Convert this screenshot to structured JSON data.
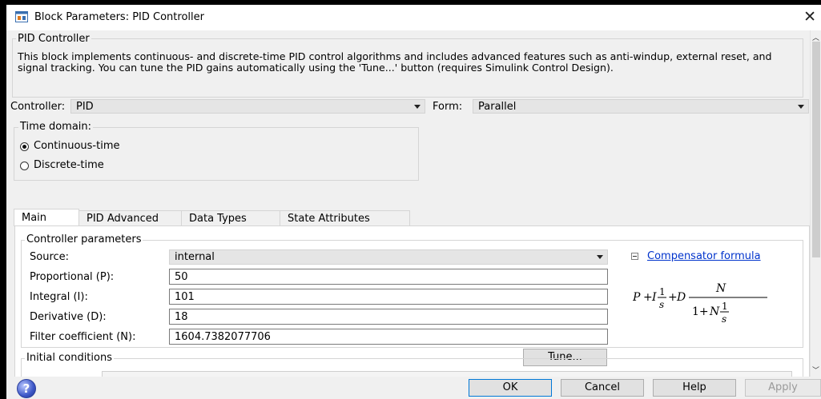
{
  "window": {
    "title": "Block Parameters: PID Controller"
  },
  "block": {
    "name": "PID Controller",
    "description": "This block implements continuous- and discrete-time PID control algorithms and includes advanced features such as anti-windup, external reset, and signal tracking. You can tune the PID gains automatically using the 'Tune...' button (requires Simulink Control Design)."
  },
  "controller": {
    "label": "Controller:",
    "value": "PID"
  },
  "form": {
    "label": "Form:",
    "value": "Parallel"
  },
  "time_domain": {
    "title": "Time domain:",
    "options": [
      {
        "label": "Continuous-time",
        "selected": true
      },
      {
        "label": "Discrete-time",
        "selected": false
      }
    ]
  },
  "tabs": [
    {
      "label": "Main",
      "active": true
    },
    {
      "label": "PID Advanced",
      "active": false
    },
    {
      "label": "Data Types",
      "active": false
    },
    {
      "label": "State Attributes",
      "active": false
    }
  ],
  "controller_parameters": {
    "title": "Controller parameters",
    "source": {
      "label": "Source:",
      "value": "internal"
    },
    "proportional": {
      "label": "Proportional (P):",
      "value": "50"
    },
    "integral": {
      "label": "Integral (I):",
      "value": "101"
    },
    "derivative": {
      "label": "Derivative (D):",
      "value": "18"
    },
    "filter": {
      "label": "Filter coefficient (N):",
      "value": "1604.7382077706"
    },
    "tune_label": "Tune...",
    "compensator_link": "Compensator formula"
  },
  "formula": {
    "P": "P",
    "plus1": "+",
    "I": "I",
    "one1": "1",
    "s1": "s",
    "plus2": "+",
    "D": "D",
    "N_num": "N",
    "one_plus": "1+",
    "N_den": "N",
    "one2": "1",
    "s2": "s"
  },
  "initial_conditions": {
    "title": "Initial conditions"
  },
  "buttons": {
    "ok": "OK",
    "cancel": "Cancel",
    "help": "Help",
    "apply": "Apply"
  },
  "icons": [
    "block-window-icon",
    "close-icon",
    "help-icon",
    "dropdown-arrow-icon",
    "collapse-icon",
    "scroll-up-icon",
    "scroll-down-icon"
  ]
}
